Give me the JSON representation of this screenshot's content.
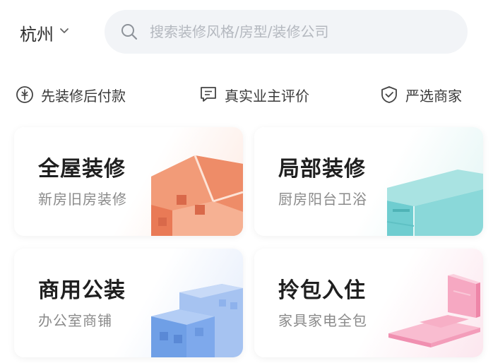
{
  "header": {
    "city": "杭州",
    "search_placeholder": "搜索装修风格/房型/装修公司"
  },
  "features": [
    {
      "label": "先装修后付款",
      "icon": "coin-icon"
    },
    {
      "label": "真实业主评价",
      "icon": "comment-icon"
    },
    {
      "label": "严选商家",
      "icon": "shield-check-icon"
    }
  ],
  "cards": [
    {
      "title": "全屋装修",
      "subtitle": "新房旧房装修",
      "icon": "house-icon",
      "color": "#f08a68"
    },
    {
      "title": "局部装修",
      "subtitle": "厨房阳台卫浴",
      "icon": "cabinet-icon",
      "color": "#6fcdd0"
    },
    {
      "title": "商用公装",
      "subtitle": "办公室商铺",
      "icon": "office-building-icon",
      "color": "#6f9fe6"
    },
    {
      "title": "拎包入住",
      "subtitle": "家具家电全包",
      "icon": "furniture-icon",
      "color": "#f38fb0"
    }
  ]
}
